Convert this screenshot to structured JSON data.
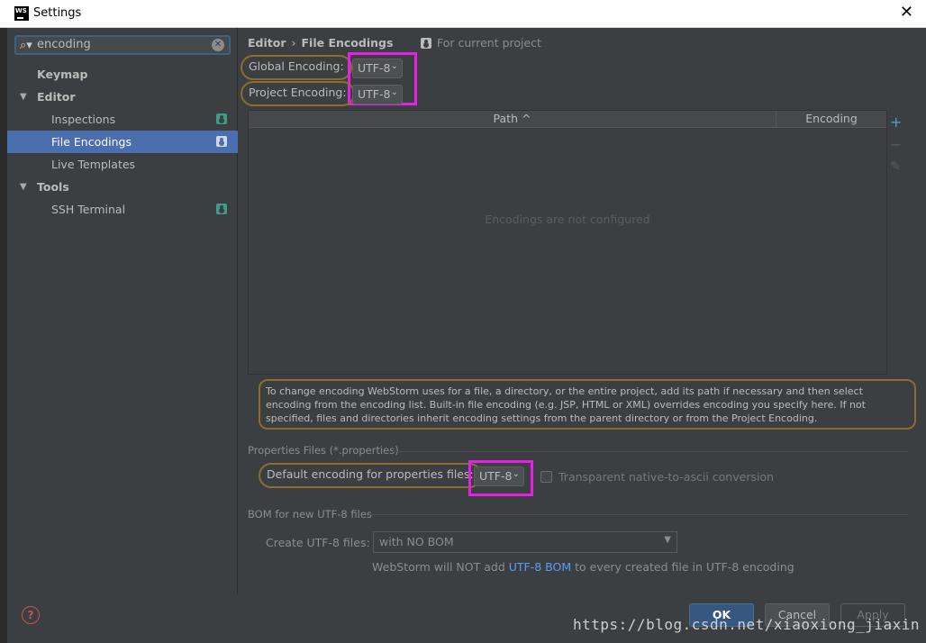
{
  "window": {
    "title": "Settings",
    "close_glyph": "✕"
  },
  "search": {
    "value": "encoding",
    "clear_glyph": "✕"
  },
  "sidebar": {
    "items": [
      {
        "label": "Keymap"
      },
      {
        "label": "Editor"
      },
      {
        "label": "Inspections"
      },
      {
        "label": "File Encodings"
      },
      {
        "label": "Live Templates"
      },
      {
        "label": "Tools"
      },
      {
        "label": "SSH Terminal"
      }
    ]
  },
  "breadcrumb": {
    "section": "Editor",
    "separator": "›",
    "page": "File Encodings"
  },
  "scope": {
    "label": "For current project"
  },
  "global_encoding": {
    "label": "Global Encoding:",
    "value": "UTF-8"
  },
  "project_encoding": {
    "label": "Project Encoding:",
    "value": "UTF-8"
  },
  "table": {
    "columns": [
      "Path ^",
      "Encoding"
    ],
    "empty_message": "Encodings are not configured"
  },
  "toolbar": {
    "add": "+",
    "remove": "−",
    "edit": "✎"
  },
  "info": "To change encoding WebStorm uses for a file, a directory, or the entire project, add its path if necessary and then select encoding from the encoding list. Built-in file encoding (e.g. JSP, HTML or XML) overrides encoding you specify here. If not specified, files and directories inherit encoding settings from the parent directory or from the Project Encoding.",
  "properties": {
    "section_label": "Properties Files (*.properties)",
    "default_label": "Default encoding for properties files:",
    "default_value": "UTF-8",
    "transparent_label": "Transparent native-to-ascii conversion"
  },
  "bom": {
    "section_label": "BOM for new UTF-8 files",
    "create_label": "Create UTF-8 files:",
    "create_value": "with NO BOM",
    "note_prefix": "WebStorm will NOT add ",
    "note_link": "UTF-8 BOM",
    "note_suffix": " to every created file in UTF-8 encoding"
  },
  "buttons": {
    "ok": "OK",
    "cancel": "Cancel",
    "apply": "Apply",
    "help": "?"
  },
  "watermark": "https://blog.csdn.net/xiaoxiong_jiaxin",
  "colors": {
    "accent": "#4b6eaf",
    "highlight_box": "#e620e6",
    "callout": "#8c6d31",
    "link": "#589df6"
  }
}
